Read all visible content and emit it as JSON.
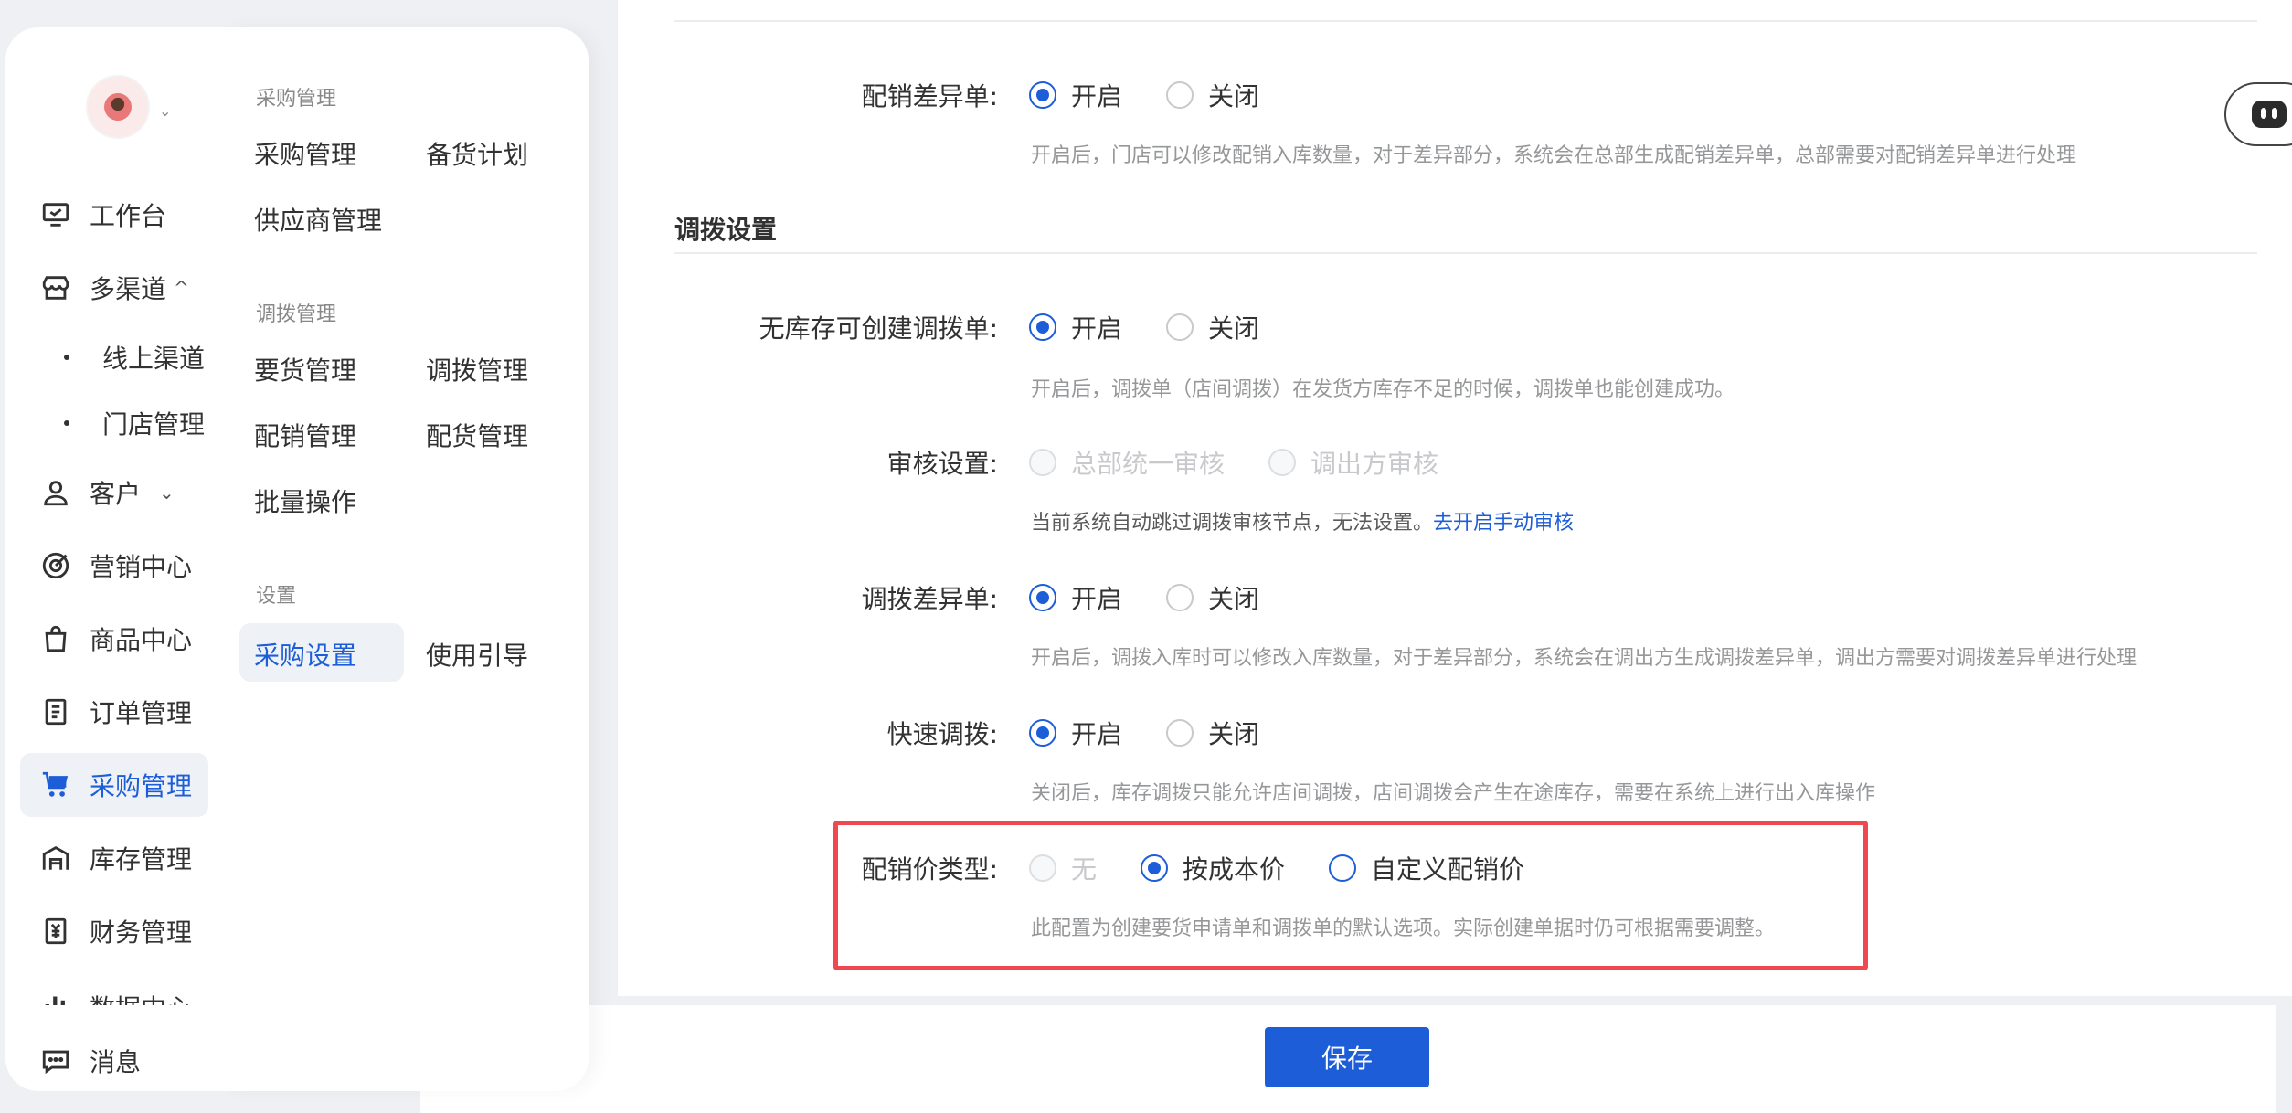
{
  "sidebar": {
    "items": [
      {
        "label": "工作台",
        "icon": "workbench-icon"
      },
      {
        "label": "多渠道",
        "icon": "store-icon",
        "chevron": "^"
      },
      {
        "label": "线上渠道"
      },
      {
        "label": "门店管理"
      },
      {
        "label": "客户",
        "icon": "user-icon",
        "chevron": "⌄"
      },
      {
        "label": "营销中心",
        "icon": "target-icon"
      },
      {
        "label": "商品中心",
        "icon": "bag-icon"
      },
      {
        "label": "订单管理",
        "icon": "order-icon"
      },
      {
        "label": "采购管理",
        "icon": "cart-icon",
        "active": true
      },
      {
        "label": "库存管理",
        "icon": "warehouse-icon"
      },
      {
        "label": "财务管理",
        "icon": "finance-icon"
      },
      {
        "label": "数据中心",
        "icon": "chart-icon"
      },
      {
        "label": "消息",
        "icon": "message-icon"
      }
    ]
  },
  "submenu": {
    "groups": [
      {
        "title": "采购管理",
        "links": [
          "采购管理",
          "备货计划",
          "供应商管理"
        ]
      },
      {
        "title": "调拨管理",
        "links": [
          "要货管理",
          "调拨管理",
          "配销管理",
          "配货管理",
          "批量操作"
        ]
      },
      {
        "title": "设置",
        "links": [
          "采购设置",
          "使用引导"
        ]
      }
    ]
  },
  "settings": {
    "peixiao_diff": {
      "label": "配销差异单:",
      "on": "开启",
      "off": "关闭",
      "hint": "开启后，门店可以修改配销入库数量，对于差异部分，系统会在总部生成配销差异单，总部需要对配销差异单进行处理"
    },
    "section_title": "调拨设置",
    "no_stock": {
      "label": "无库存可创建调拨单:",
      "on": "开启",
      "off": "关闭",
      "hint": "开启后，调拨单（店间调拨）在发货方库存不足的时候，调拨单也能创建成功。"
    },
    "audit": {
      "label": "审核设置:",
      "opt1": "总部统一审核",
      "opt2": "调出方审核",
      "hint": "当前系统自动跳过调拨审核节点，无法设置。",
      "link": "去开启手动审核"
    },
    "transfer_diff": {
      "label": "调拨差异单:",
      "on": "开启",
      "off": "关闭",
      "hint": "开启后，调拨入库时可以修改入库数量，对于差异部分，系统会在调出方生成调拨差异单，调出方需要对调拨差异单进行处理"
    },
    "quick": {
      "label": "快速调拨:",
      "on": "开启",
      "off": "关闭",
      "hint": "关闭后，库存调拨只能允许店间调拨，店间调拨会产生在途库存，需要在系统上进行出入库操作"
    },
    "price_type": {
      "label": "配销价类型:",
      "opt0": "无",
      "opt1": "按成本价",
      "opt2": "自定义配销价",
      "hint": "此配置为创建要货申请单和调拨单的默认选项。实际创建单据时仍可根据需要调整。"
    }
  },
  "footer": {
    "save": "保存"
  }
}
